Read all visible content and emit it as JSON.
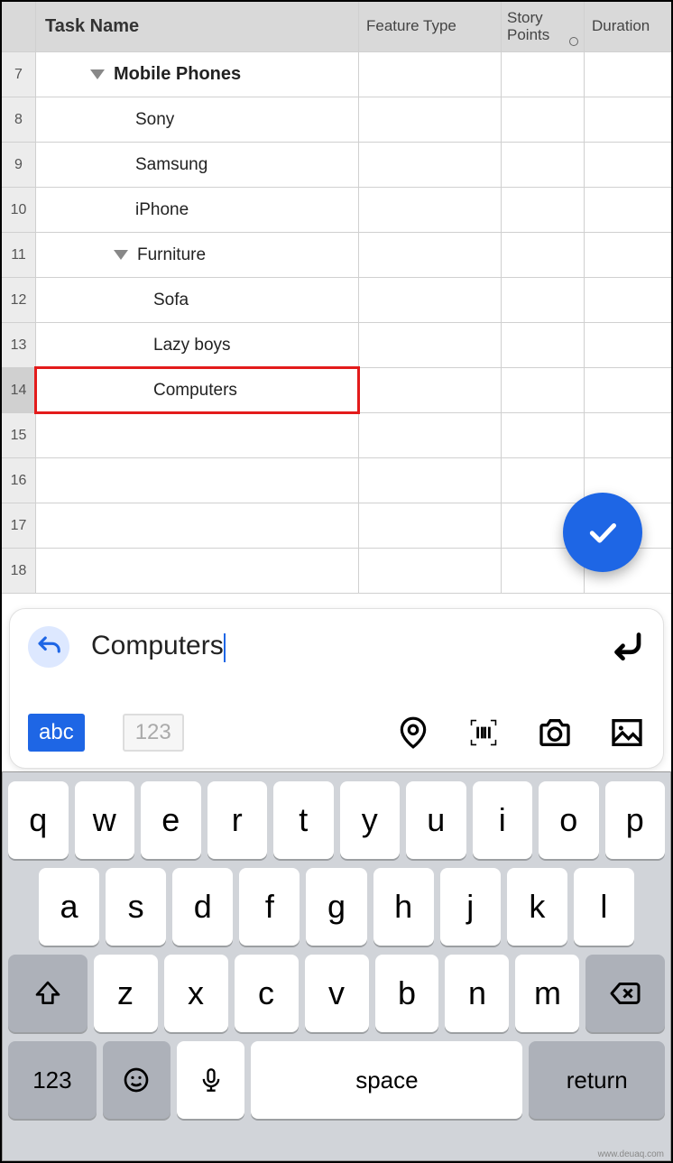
{
  "columns": {
    "task": "Task Name",
    "feature": "Feature Type",
    "story": "Story Points",
    "duration": "Duration"
  },
  "rows": [
    {
      "num": "7",
      "text": "Mobile Phones",
      "bold": true,
      "indent": "indent-1",
      "disclosure": true
    },
    {
      "num": "8",
      "text": "Sony",
      "bold": false,
      "indent": "indent-2"
    },
    {
      "num": "9",
      "text": "Samsung",
      "bold": false,
      "indent": "indent-2"
    },
    {
      "num": "10",
      "text": "iPhone",
      "bold": false,
      "indent": "indent-2"
    },
    {
      "num": "11",
      "text": "Furniture",
      "bold": false,
      "indent": "indent-2b",
      "disclosure": true
    },
    {
      "num": "12",
      "text": "Sofa",
      "bold": false,
      "indent": "indent-3"
    },
    {
      "num": "13",
      "text": "Lazy boys",
      "bold": false,
      "indent": "indent-3"
    },
    {
      "num": "14",
      "text": "Computers",
      "bold": false,
      "indent": "indent-3",
      "highlighted": true
    },
    {
      "num": "15",
      "text": ""
    },
    {
      "num": "16",
      "text": ""
    },
    {
      "num": "17",
      "text": ""
    },
    {
      "num": "18",
      "text": ""
    }
  ],
  "input": {
    "value": "Computers",
    "mode_abc": "abc",
    "mode_123": "123"
  },
  "keyboard": {
    "row1": [
      "q",
      "w",
      "e",
      "r",
      "t",
      "y",
      "u",
      "i",
      "o",
      "p"
    ],
    "row2": [
      "a",
      "s",
      "d",
      "f",
      "g",
      "h",
      "j",
      "k",
      "l"
    ],
    "row3": [
      "z",
      "x",
      "c",
      "v",
      "b",
      "n",
      "m"
    ],
    "row4": {
      "num": "123",
      "space": "space",
      "return": "return"
    }
  },
  "watermark": "www.deuaq.com"
}
